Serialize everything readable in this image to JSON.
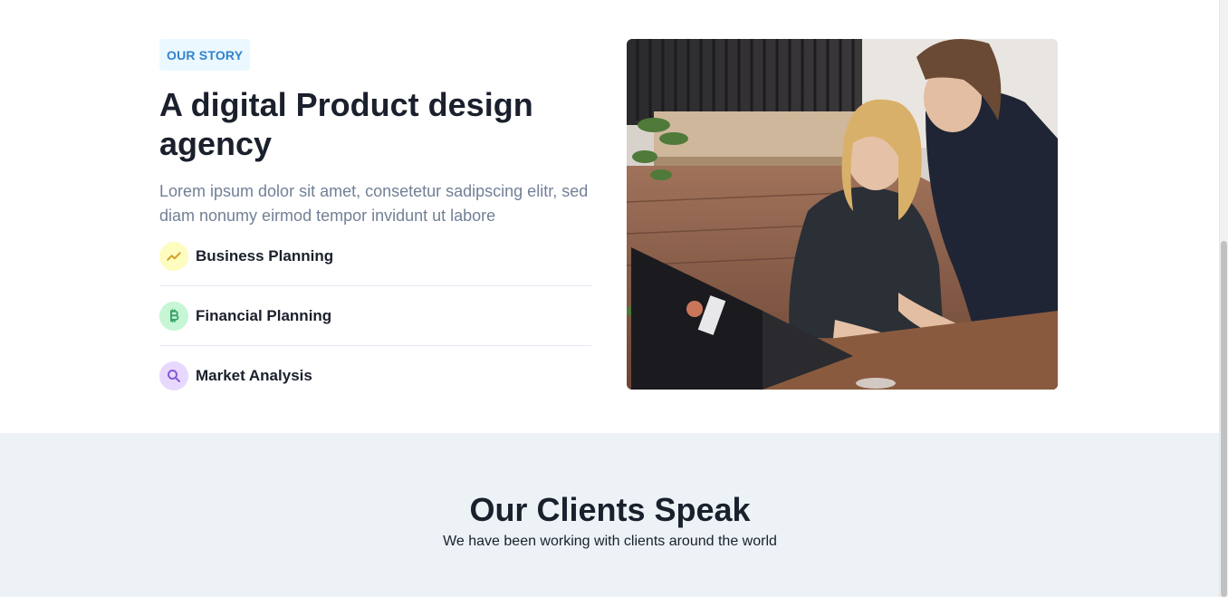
{
  "story": {
    "tag": "OUR STORY",
    "title": "A digital Product design agency",
    "description": "Lorem ipsum dolor sit amet, consetetur sadipscing elitr, sed diam nonumy eirmod tempor invidunt ut labore",
    "features": [
      {
        "label": "Business Planning",
        "icon": "trending-up-icon",
        "icon_bg": "#fefcbf",
        "icon_color": "#d69e2e"
      },
      {
        "label": "Financial Planning",
        "icon": "bitcoin-icon",
        "icon_bg": "#c6f6d5",
        "icon_color": "#38a169"
      },
      {
        "label": "Market Analysis",
        "icon": "search-icon",
        "icon_bg": "#e9d8fd",
        "icon_color": "#805ad5"
      }
    ]
  },
  "clients": {
    "title": "Our Clients Speak",
    "subtitle": "We have been working with clients around the world"
  },
  "colors": {
    "accent": "#3182ce",
    "heading": "#1a202c",
    "muted": "#718096",
    "section_bg": "#edf2f7"
  }
}
